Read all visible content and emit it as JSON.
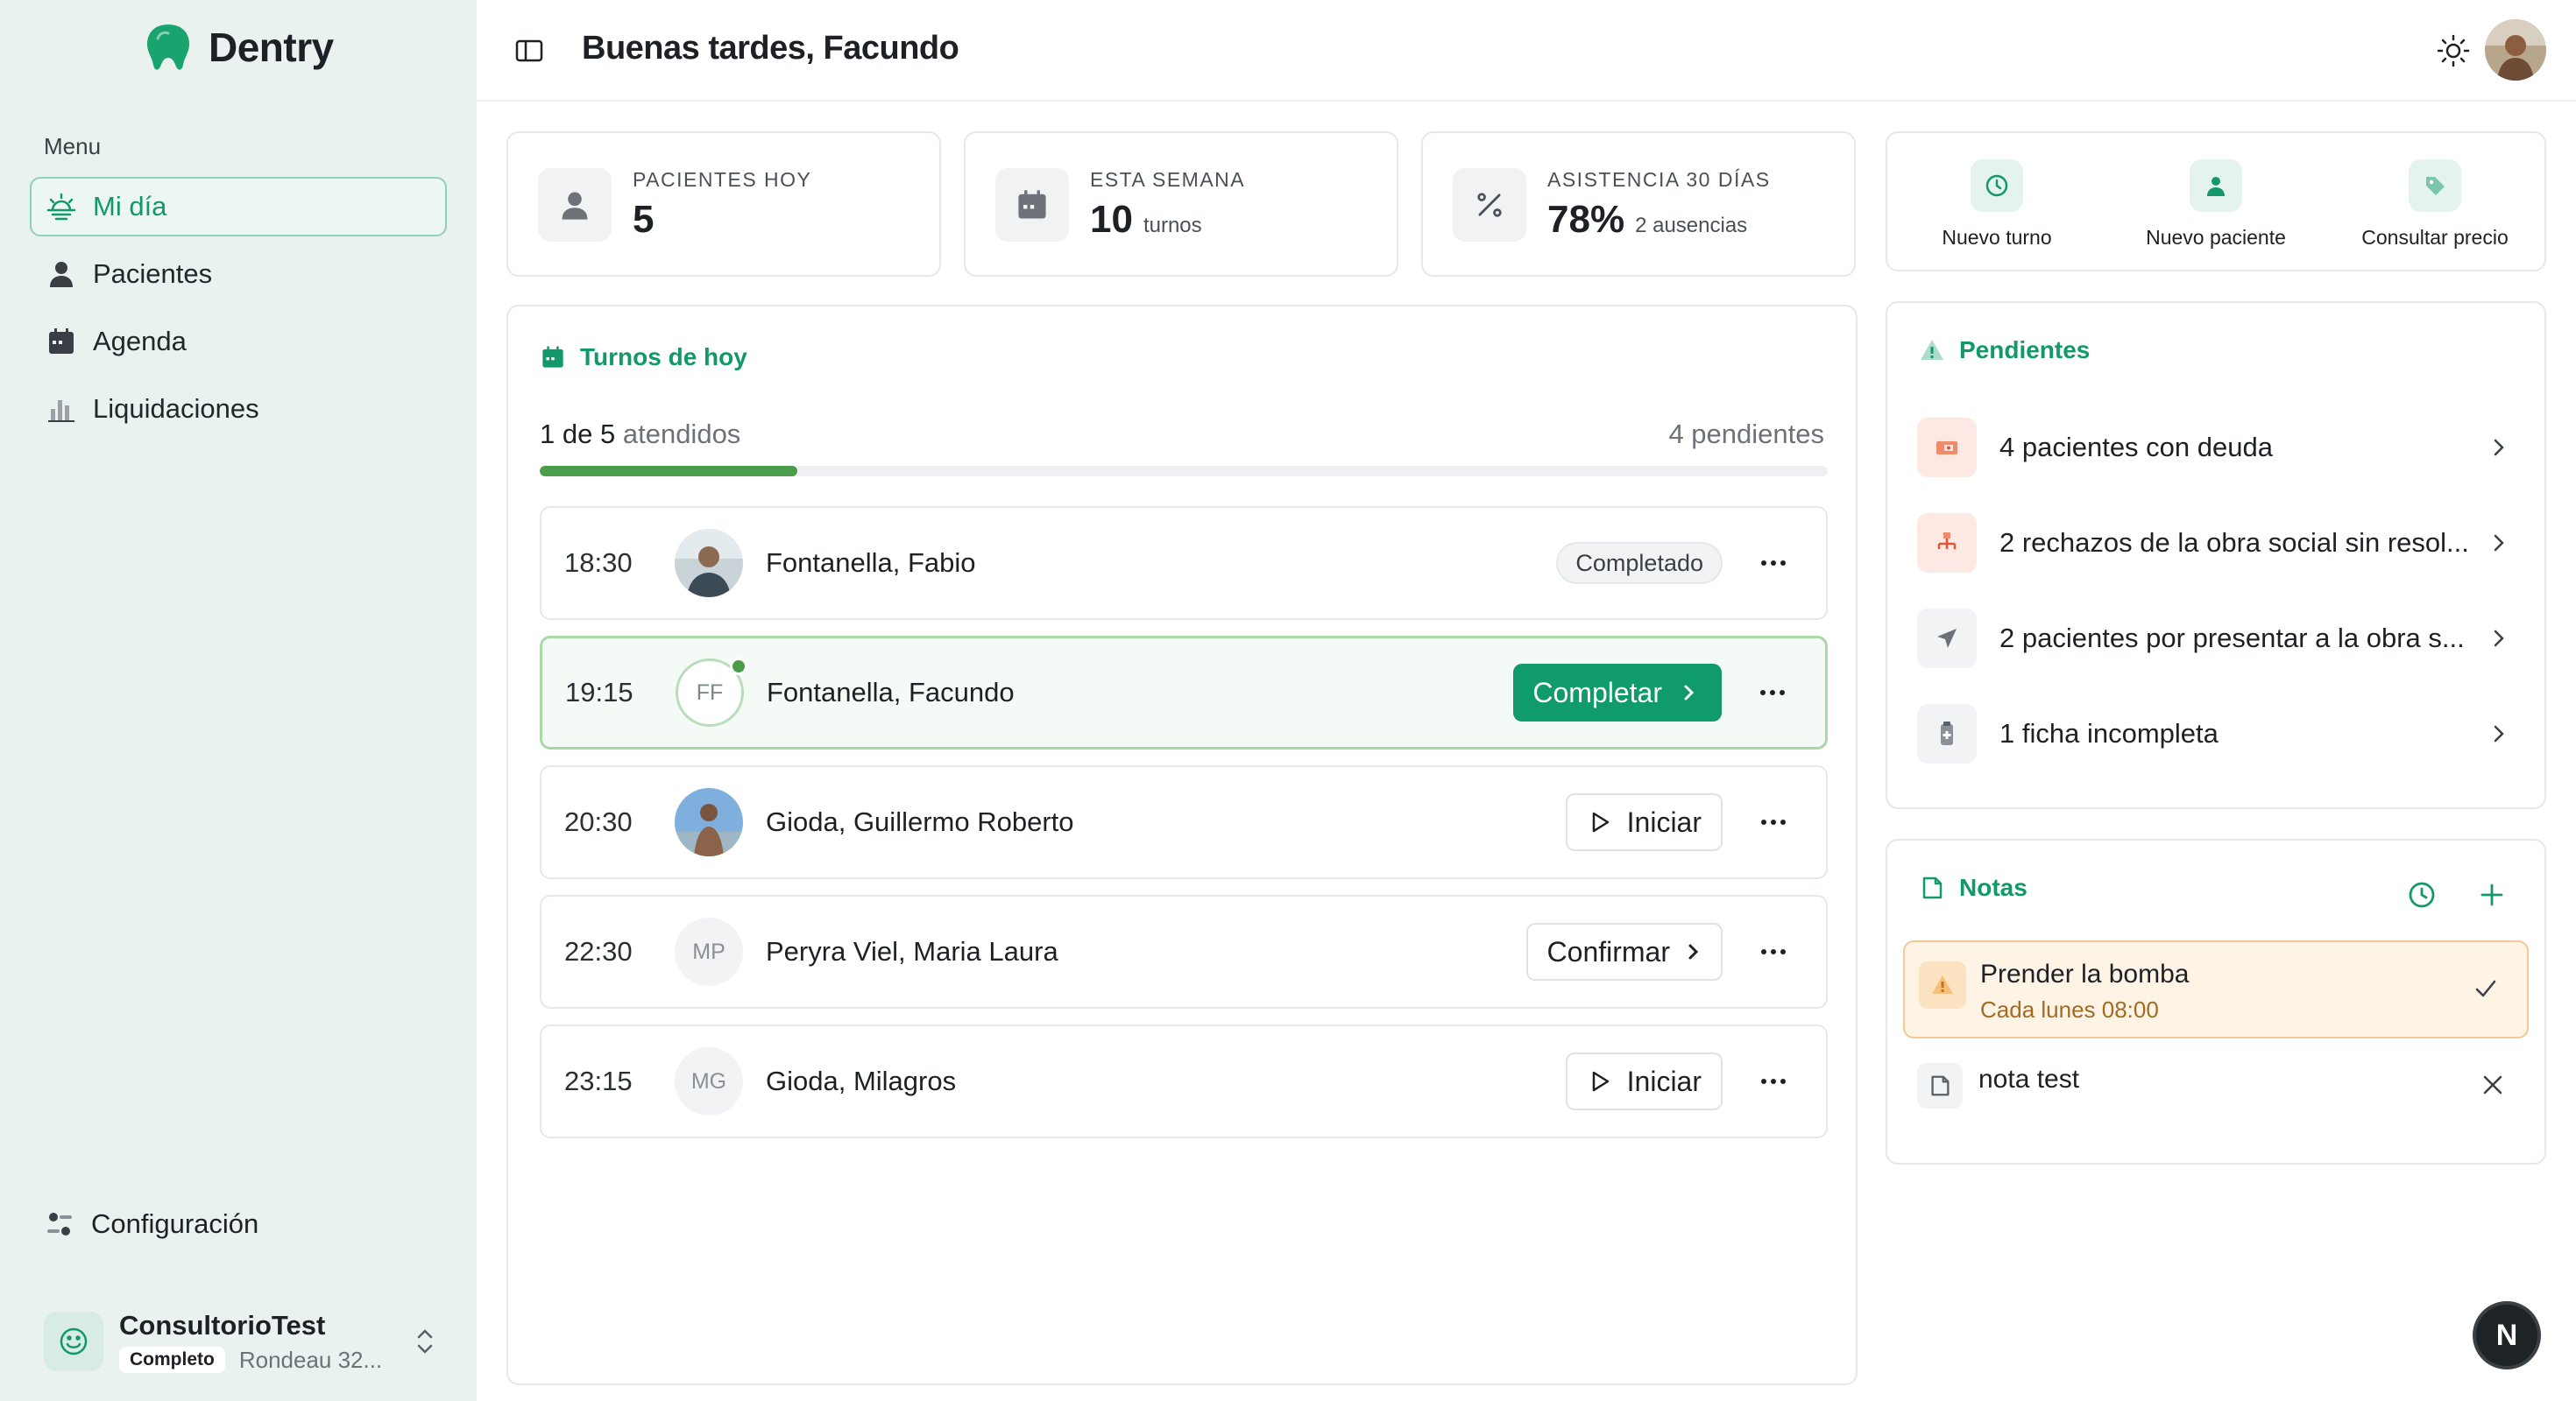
{
  "app": {
    "brand": "Dentry",
    "accent": "#13986a",
    "sidebar_bg": "#e9f2ef"
  },
  "sidebar": {
    "menu_label": "Menu",
    "items": [
      {
        "label": "Mi día",
        "icon": "sun-horizon-icon",
        "active": true
      },
      {
        "label": "Pacientes",
        "icon": "user-icon",
        "active": false
      },
      {
        "label": "Agenda",
        "icon": "calendar-icon",
        "active": false
      },
      {
        "label": "Liquidaciones",
        "icon": "bar-chart-icon",
        "active": false
      }
    ],
    "config_label": "Configuración",
    "account": {
      "name": "ConsultorioTest",
      "badge": "Completo",
      "address": "Rondeau 32..."
    }
  },
  "header": {
    "greeting": "Buenas tardes, Facundo"
  },
  "stats": [
    {
      "label": "PACIENTES HOY",
      "value": "5",
      "suffix": ""
    },
    {
      "label": "ESTA SEMANA",
      "value": "10",
      "suffix": "turnos"
    },
    {
      "label": "ASISTENCIA 30 DÍAS",
      "value": "78%",
      "suffix": "2 ausencias"
    }
  ],
  "quick_actions": [
    {
      "label": "Nuevo turno",
      "icon": "clock-icon"
    },
    {
      "label": "Nuevo paciente",
      "icon": "user-add-icon"
    },
    {
      "label": "Consultar precio",
      "icon": "tag-icon"
    }
  ],
  "turnos": {
    "title": "Turnos de hoy",
    "done": "1",
    "total": "5",
    "done_prefix": "de",
    "done_suffix": "atendidos",
    "pending_label": "4 pendientes",
    "progress": 0.2,
    "rows": [
      {
        "time": "18:30",
        "name": "Fontanella, Fabio",
        "initials": "",
        "action": "Completado",
        "action_type": "status"
      },
      {
        "time": "19:15",
        "name": "Fontanella, Facundo",
        "initials": "FF",
        "action": "Completar",
        "action_type": "primary"
      },
      {
        "time": "20:30",
        "name": "Gioda, Guillermo Roberto",
        "initials": "",
        "action": "Iniciar",
        "action_type": "play"
      },
      {
        "time": "22:30",
        "name": "Peryra Viel, Maria Laura",
        "initials": "MP",
        "action": "Confirmar",
        "action_type": "chevron"
      },
      {
        "time": "23:15",
        "name": "Gioda, Milagros",
        "initials": "MG",
        "action": "Iniciar",
        "action_type": "play"
      }
    ]
  },
  "pendientes": {
    "title": "Pendientes",
    "items": [
      {
        "text": "4 pacientes con deuda",
        "icon": "money-icon"
      },
      {
        "text": "2 rechazos de la obra social sin resol...",
        "icon": "network-icon"
      },
      {
        "text": "2 pacientes por presentar a la obra s...",
        "icon": "send-icon"
      },
      {
        "text": "1 ficha incompleta",
        "icon": "clipboard-icon"
      }
    ]
  },
  "notas": {
    "title": "Notas",
    "items": [
      {
        "title": "Prender la bomba",
        "subtitle": "Cada lunes 08:00",
        "type": "recurring"
      },
      {
        "title": "nota test",
        "subtitle": "",
        "type": "plain"
      }
    ]
  },
  "fab_label": "N"
}
